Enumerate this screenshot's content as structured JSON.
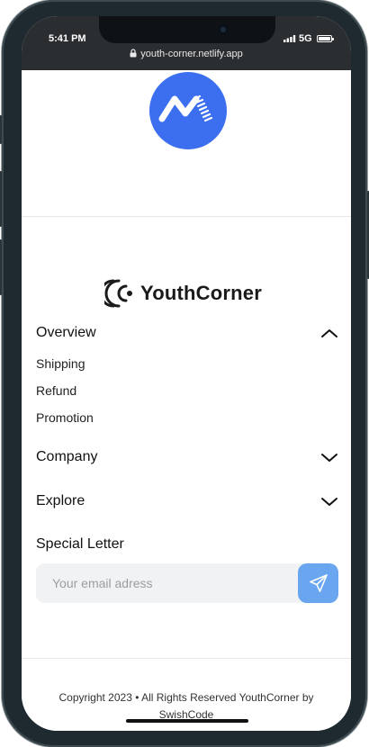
{
  "status_bar": {
    "time": "5:41 PM",
    "network": "5G",
    "url": "youth-corner.netlify.app"
  },
  "brand": {
    "name": "YouthCorner",
    "accent_color": "#3b6ff0"
  },
  "accordions": [
    {
      "title": "Overview",
      "expanded": true,
      "links": [
        "Shipping",
        "Refund",
        "Promotion"
      ]
    },
    {
      "title": "Company",
      "expanded": false
    },
    {
      "title": "Explore",
      "expanded": false
    }
  ],
  "newsletter": {
    "title": "Special Letter",
    "placeholder": "Your email adress",
    "send_icon": "send-icon",
    "button_color": "#6aa6f0"
  },
  "footer": {
    "copyright": "Copyright 2023 • All Rights Reserved YouthCorner by SwishCode"
  }
}
